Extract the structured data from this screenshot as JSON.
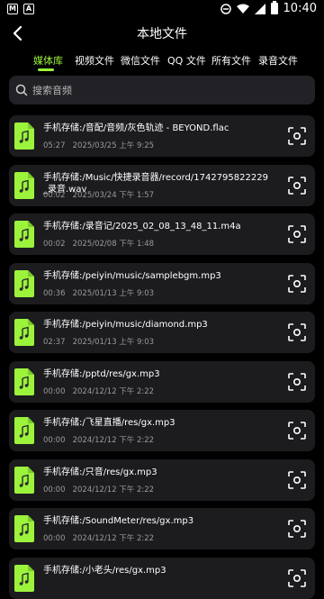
{
  "status": {
    "time": "10:40",
    "left_icons": [
      "notification-icon-1",
      "notification-icon-2"
    ]
  },
  "header": {
    "title": "本地文件"
  },
  "tabs": [
    {
      "label": "媒体库",
      "active": true
    },
    {
      "label": "视频文件",
      "active": false
    },
    {
      "label": "微信文件",
      "active": false
    },
    {
      "label": "QQ 文件",
      "active": false
    },
    {
      "label": "所有文件",
      "active": false
    },
    {
      "label": "录音文件",
      "active": false
    }
  ],
  "search": {
    "placeholder": "搜索音频"
  },
  "colors": {
    "accent": "#9bf33c",
    "card": "#1c1c1f",
    "background": "#000000"
  },
  "files": [
    {
      "name": "手机存储:/音配/音频/灰色轨迹 - BEYOND.flac",
      "duration": "05:27",
      "date": "2025/03/25 上午 9:25"
    },
    {
      "name": "手机存储:/Music/快捷录音器/record/1742795822229_录音.wav",
      "duration": "00:02",
      "date": "2025/03/24 下午 1:57"
    },
    {
      "name": "手机存储:/录音记/2025_02_08_13_48_11.m4a",
      "duration": "00:02",
      "date": "2025/02/08 下午 1:48"
    },
    {
      "name": "手机存储:/peiyin/music/samplebgm.mp3",
      "duration": "00:36",
      "date": "2025/01/13 上午 9:03"
    },
    {
      "name": "手机存储:/peiyin/music/diamond.mp3",
      "duration": "02:37",
      "date": "2025/01/13 上午 9:03"
    },
    {
      "name": "手机存储:/pptd/res/gx.mp3",
      "duration": "00:00",
      "date": "2024/12/12 下午 2:22"
    },
    {
      "name": "手机存储:/飞星直播/res/gx.mp3",
      "duration": "00:00",
      "date": "2024/12/12 下午 2:22"
    },
    {
      "name": "手机存储:/只音/res/gx.mp3",
      "duration": "00:00",
      "date": "2024/12/12 下午 2:22"
    },
    {
      "name": "手机存储:/SoundMeter/res/gx.mp3",
      "duration": "00:00",
      "date": "2024/12/12 下午 2:22"
    },
    {
      "name": "手机存储:/小老头/res/gx.mp3",
      "duration": "",
      "date": ""
    }
  ]
}
